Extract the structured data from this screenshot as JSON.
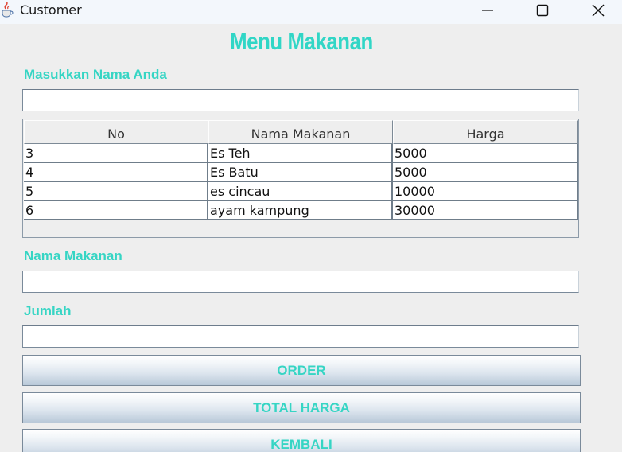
{
  "window": {
    "title": "Customer",
    "app_icon": "java-cup-icon",
    "controls": [
      "minimize-icon",
      "maximize-icon",
      "close-icon"
    ]
  },
  "heading": "Menu Makanan",
  "form": {
    "name_label": "Masukkan Nama Anda",
    "name_value": "",
    "food_label": "Nama Makanan",
    "food_value": "",
    "qty_label": "Jumlah",
    "qty_value": ""
  },
  "table": {
    "columns": [
      "No",
      "Nama Makanan",
      "Harga"
    ],
    "rows": [
      [
        "3",
        "Es Teh",
        "5000"
      ],
      [
        "4",
        "Es Batu",
        "5000"
      ],
      [
        "5",
        "es cincau",
        "10000"
      ],
      [
        "6",
        "ayam kampung",
        "30000"
      ]
    ]
  },
  "buttons": {
    "order": "ORDER",
    "total": "TOTAL HARGA",
    "back": "KEMBALI"
  },
  "colors": {
    "accent": "#36d5c4",
    "background": "#eeeeee"
  }
}
